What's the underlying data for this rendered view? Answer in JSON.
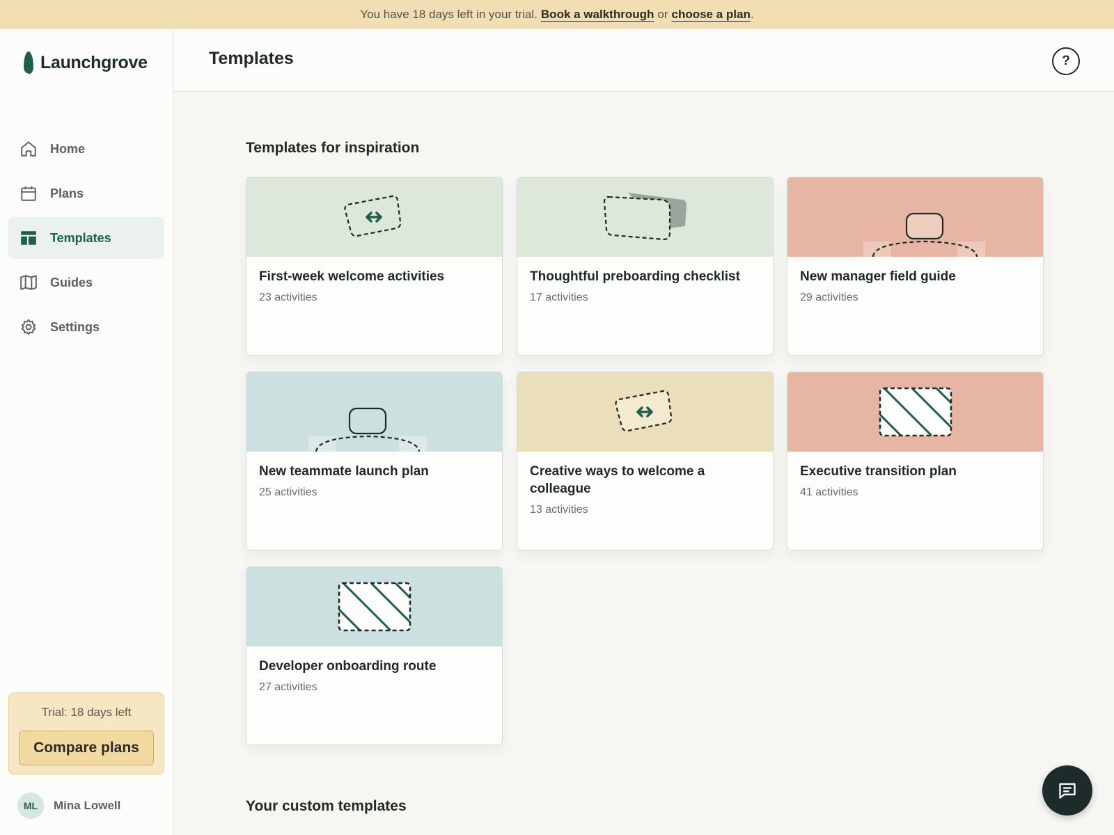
{
  "banner": {
    "text_before": "You have 18 days left in your trial.",
    "link_walkthrough": "Book a walkthrough",
    "text_or": "or",
    "link_plan": "choose a plan",
    "text_end": "."
  },
  "brand": {
    "name": "Launchgrove",
    "color": "#1f5e4b"
  },
  "sidebar": {
    "items": [
      {
        "label": "Home",
        "icon": "home-icon"
      },
      {
        "label": "Plans",
        "icon": "calendar-icon"
      },
      {
        "label": "Templates",
        "icon": "templates-icon",
        "active": true
      },
      {
        "label": "Guides",
        "icon": "book-icon"
      },
      {
        "label": "Settings",
        "icon": "gear-icon"
      }
    ],
    "trial": {
      "text": "Trial: 18 days left",
      "button": "Compare plans"
    },
    "user": {
      "initials": "ML",
      "name": "Mina Lowell"
    }
  },
  "header": {
    "title": "Templates",
    "help": "?"
  },
  "sections": {
    "inspiration": "Templates for inspiration",
    "custom": "Your custom templates"
  },
  "templates": [
    {
      "title": "First-week welcome activities",
      "count": "23 activities",
      "banner_color": "#dee8da",
      "illustration": "swap-arrows-icon"
    },
    {
      "title": "Thoughtful preboarding checklist",
      "count": "17 activities",
      "banner_color": "#dee8da",
      "illustration": "card-stack-icon"
    },
    {
      "title": "New manager field guide",
      "count": "29 activities",
      "banner_color": "#e6b5a3",
      "illustration": "person-icon"
    },
    {
      "title": "New teammate launch plan",
      "count": "25 activities",
      "banner_color": "#cde0e0",
      "illustration": "person-icon"
    },
    {
      "title": "Creative ways to welcome a colleague",
      "count": "13 activities",
      "banner_color": "#ebdfbb",
      "illustration": "swap-arrows-icon"
    },
    {
      "title": "Executive transition plan",
      "count": "41 activities",
      "banner_color": "#e6b5a3",
      "illustration": "striped-box-icon"
    },
    {
      "title": "Developer onboarding route",
      "count": "27 activities",
      "banner_color": "#cde0e0",
      "illustration": "striped-box-icon"
    }
  ]
}
